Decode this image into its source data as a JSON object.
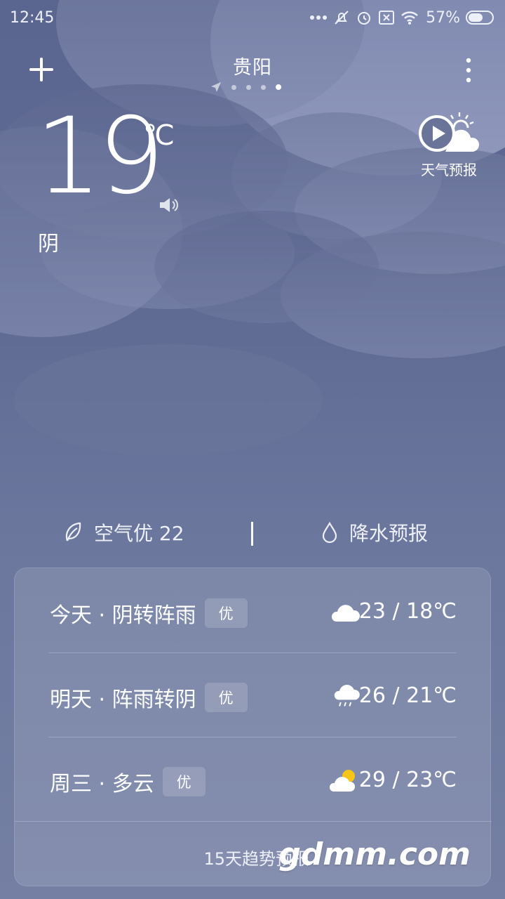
{
  "status_bar": {
    "time": "12:45",
    "battery": "57%"
  },
  "header": {
    "city": "贵阳",
    "page_dots": 4,
    "active_dot": 4
  },
  "current": {
    "temperature": "19",
    "unit": "℃",
    "condition": "阴",
    "video_label": "天气预报"
  },
  "info": {
    "aqi_label": "空气优 22",
    "rain_label": "降水预报"
  },
  "forecast": [
    {
      "desc": "今天 · 阴转阵雨",
      "aqi": "优",
      "icon": "cloud-icon",
      "range": "23 / 18℃"
    },
    {
      "desc": "明天 · 阵雨转阴",
      "aqi": "优",
      "icon": "rain-cloud-icon",
      "range": "26 / 21℃"
    },
    {
      "desc": "周三 · 多云",
      "aqi": "优",
      "icon": "partly-cloudy-icon",
      "range": "29 / 23℃"
    }
  ],
  "footer": {
    "trend": "15天趋势预报",
    "watermark": "gdmm.com"
  },
  "colors": {
    "bg_top": "#5a6690",
    "bg_bottom": "#747fa3",
    "sun": "#f5c518"
  }
}
